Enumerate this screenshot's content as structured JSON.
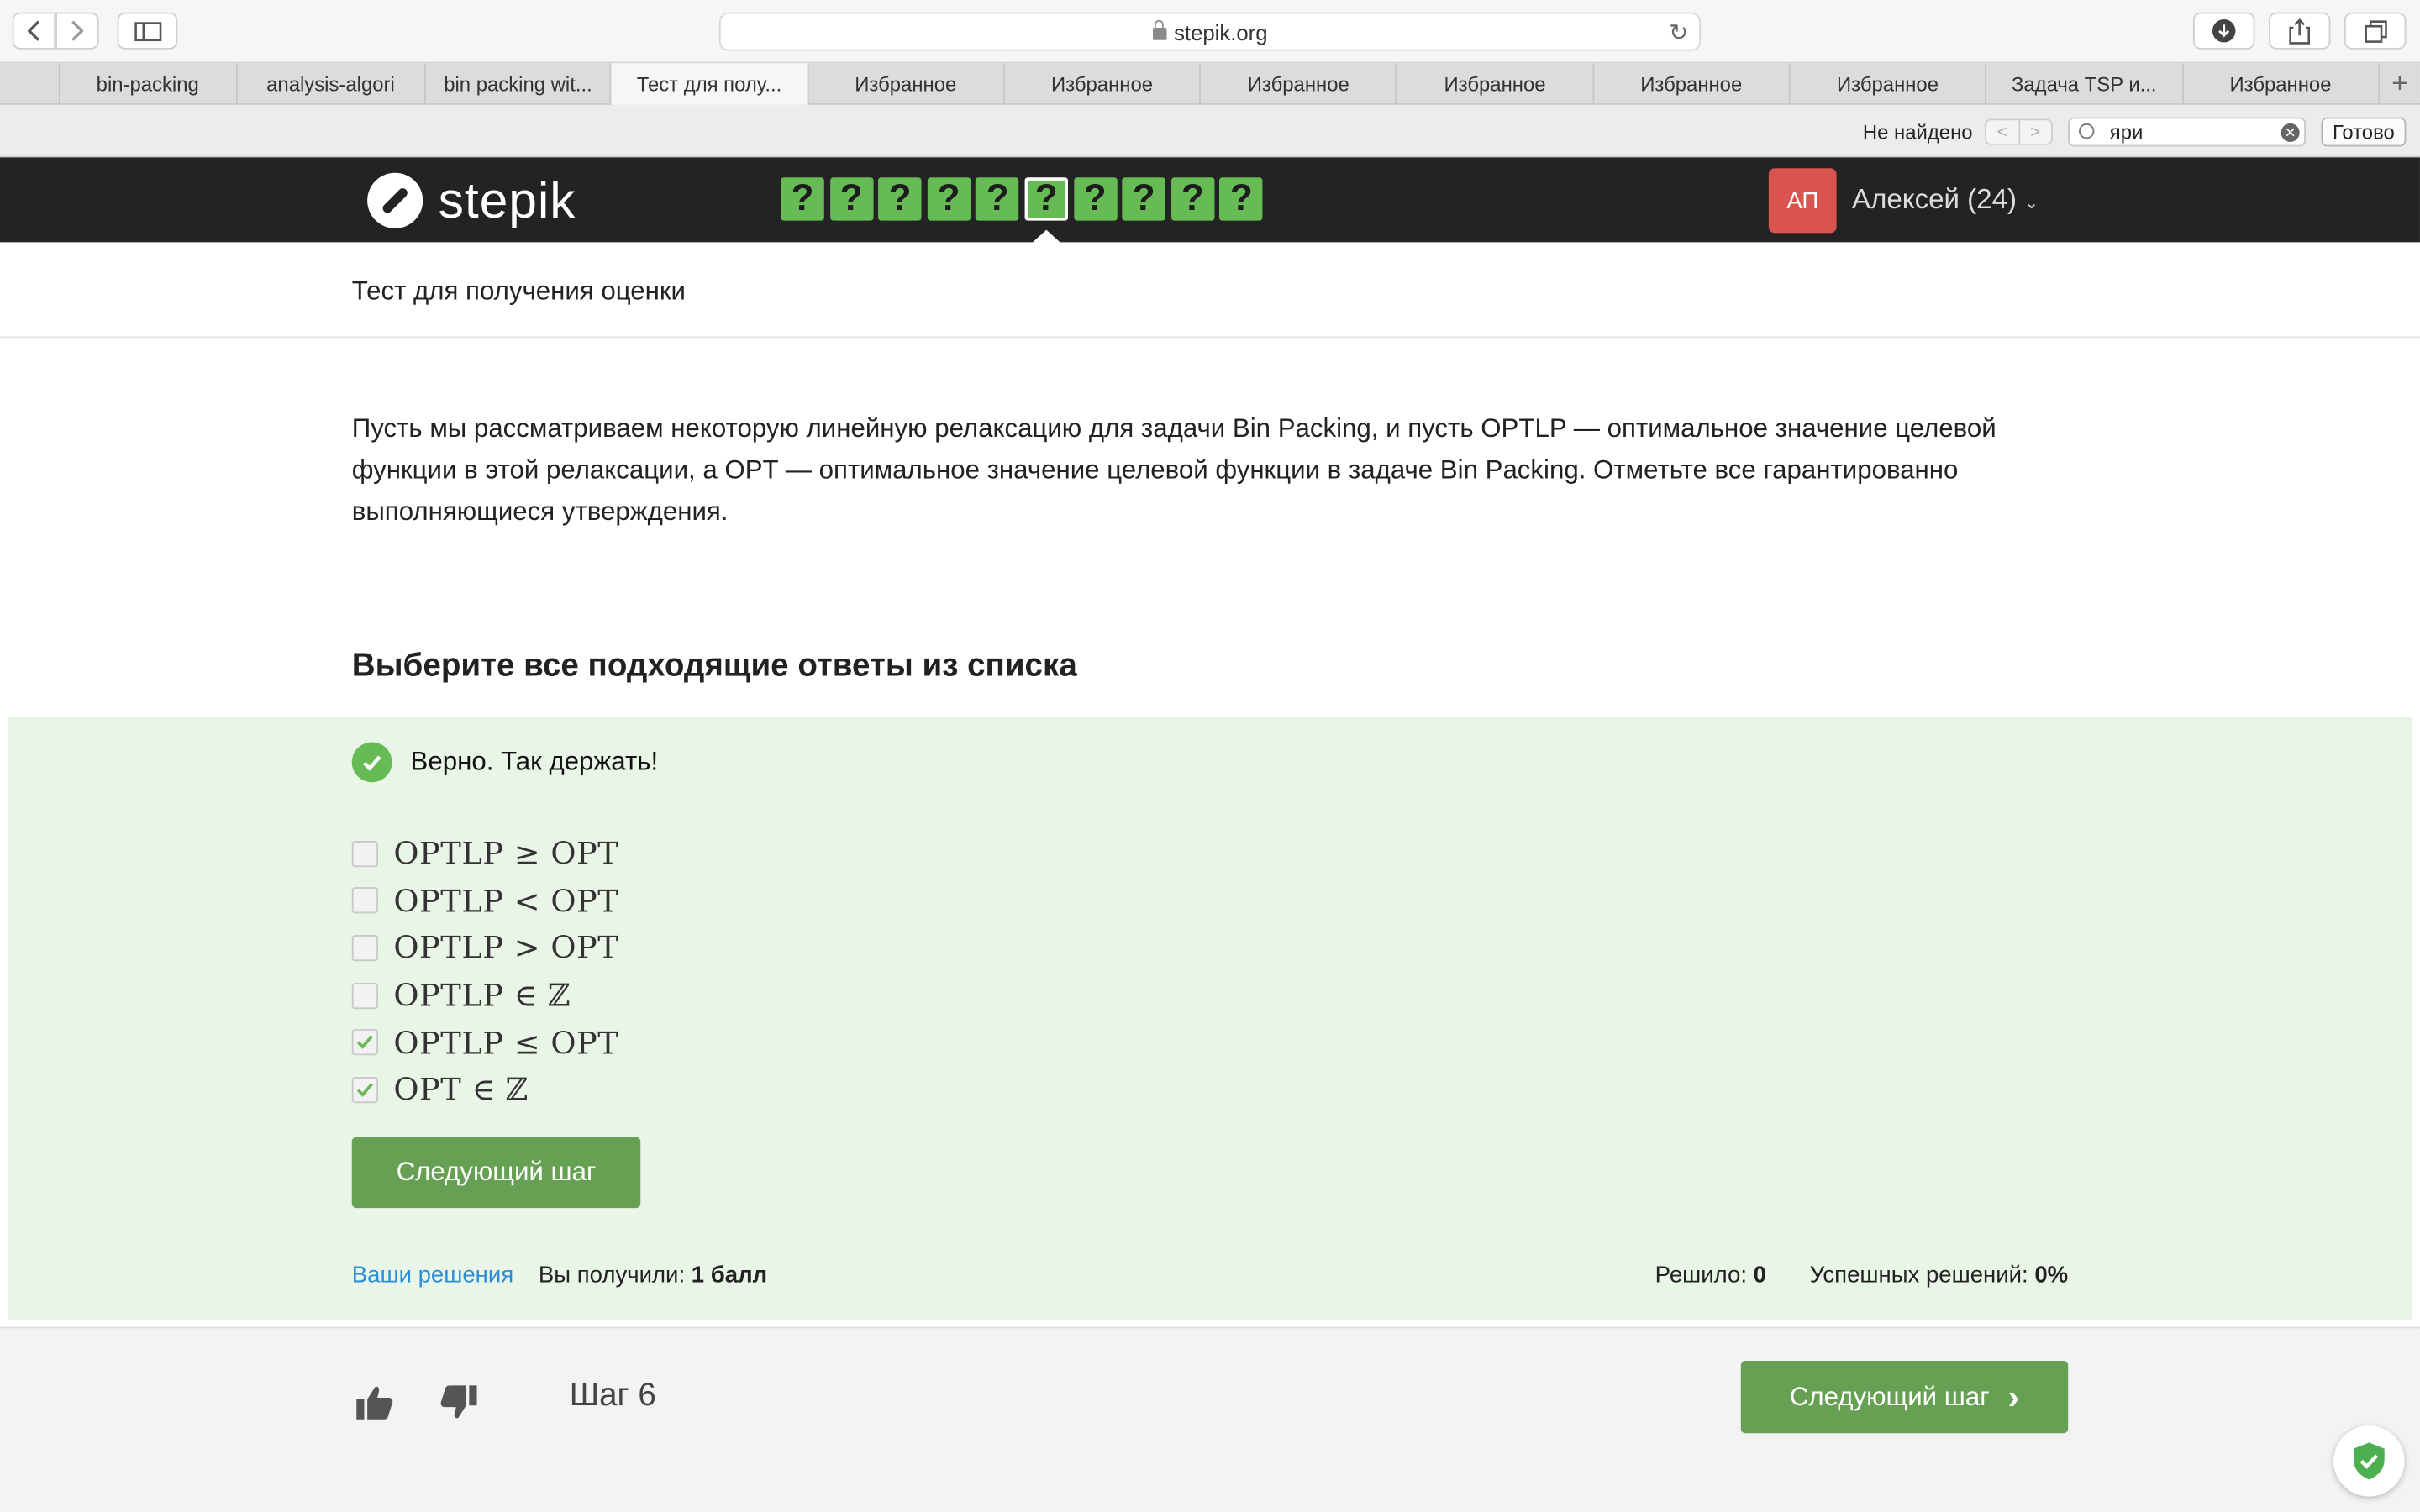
{
  "browser": {
    "url": "stepik.org",
    "tabs": [
      {
        "label": "bin-packing",
        "width": 118
      },
      {
        "label": "analysis-algori",
        "width": 126
      },
      {
        "label": "bin packing wit...",
        "width": 124
      },
      {
        "label": "Тест для полу...",
        "width": 131,
        "active": true
      },
      {
        "label": "Избранное",
        "width": 131
      },
      {
        "label": "Избранное",
        "width": 131
      },
      {
        "label": "Избранное",
        "width": 131
      },
      {
        "label": "Избранное",
        "width": 131
      },
      {
        "label": "Избранное",
        "width": 131
      },
      {
        "label": "Избранное",
        "width": 131
      },
      {
        "label": "Задача TSP и...",
        "width": 131
      },
      {
        "label": "Избранное",
        "width": 131
      }
    ]
  },
  "findbar": {
    "status": "Не найдено",
    "query": "яри",
    "done_label": "Готово"
  },
  "header": {
    "logo_text": "stepik",
    "steps": [
      "?",
      "?",
      "?",
      "?",
      "?",
      "?",
      "?",
      "?",
      "?",
      "?"
    ],
    "current_step_index": 5,
    "avatar_initials": "АП",
    "user_name": "Алексей (24)",
    "colors": {
      "bar": "#232323",
      "step_green": "#66bb55",
      "avatar": "#d9534f"
    }
  },
  "lesson": {
    "title": "Тест для получения оценки"
  },
  "question": {
    "text": "Пусть мы рассматриваем некоторую линейную релаксацию для задачи Bin Packing, и пусть OPTLP — оптимальное значение целевой функции в этой релаксации, а OPT — оптимальное значение целевой функции в задаче Bin Packing. Отметьте все гарантированно выполняющиеся утверждения.",
    "prompt": "Выберите все подходящие ответы из списка"
  },
  "result": {
    "verdict": "Верно. Так держать!",
    "options": [
      {
        "text": "OPTLP ≥ OPT",
        "checked": false
      },
      {
        "text": "OPTLP < OPT",
        "checked": false
      },
      {
        "text": "OPTLP > OPT",
        "checked": false
      },
      {
        "text": "OPTLP ∈ ℤ",
        "checked": false
      },
      {
        "text": "OPTLP ≤ OPT",
        "checked": true
      },
      {
        "text": "OPT ∈ ℤ",
        "checked": true
      }
    ],
    "next_button": "Следующий шаг",
    "your_solutions": "Ваши решения",
    "score_label": "Вы получили:",
    "score_value": "1 балл",
    "solved_label": "Решило:",
    "solved_value": "0",
    "success_label": "Успешных решений:",
    "success_value": "0%",
    "colors": {
      "panel": "#e9f5e6",
      "green": "#66a052"
    }
  },
  "footer": {
    "step_label": "Шаг 6",
    "next_button": "Следующий шаг"
  }
}
